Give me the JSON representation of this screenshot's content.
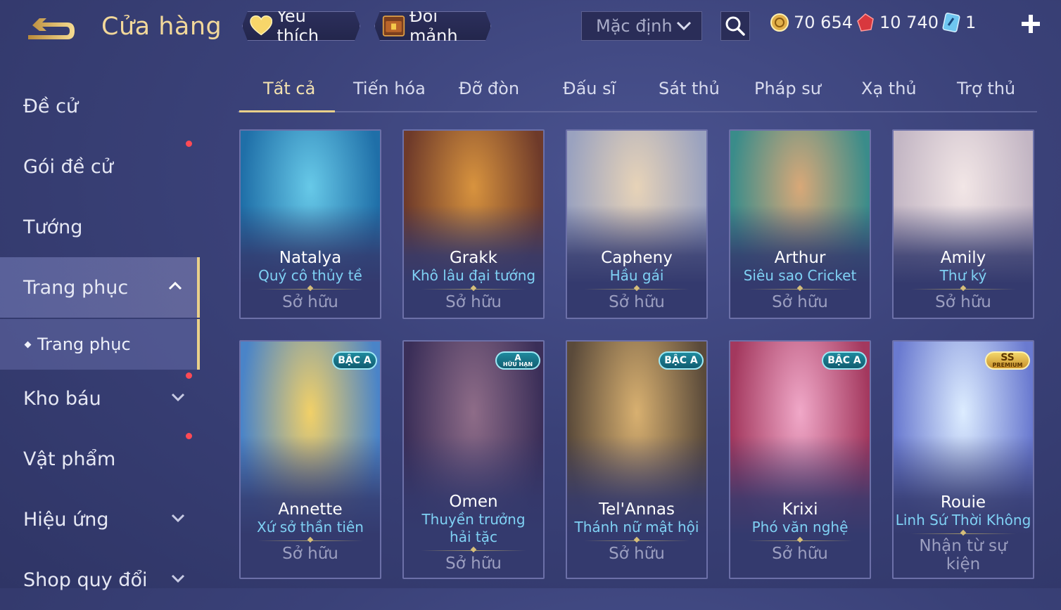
{
  "header": {
    "title": "Cửa hàng",
    "favorites_label": "Yêu thích",
    "exchange_label": "Đổi mảnh",
    "sort": {
      "selected": "Mặc định"
    },
    "currencies": [
      {
        "icon": "gold-coin-icon",
        "value": "70 654"
      },
      {
        "icon": "red-gem-icon",
        "value": "10 740"
      },
      {
        "icon": "blue-ticket-icon",
        "value": "1"
      }
    ]
  },
  "sidebar": {
    "items": [
      {
        "label": "Đề cử",
        "dot": false,
        "chevron": ""
      },
      {
        "label": "Gói đề cử",
        "dot": true,
        "chevron": ""
      },
      {
        "label": "Tướng",
        "dot": false,
        "chevron": ""
      },
      {
        "label": "Trang phục",
        "dot": false,
        "chevron": "up",
        "active": true
      },
      {
        "label": "Kho báu",
        "dot": true,
        "chevron": "down"
      },
      {
        "label": "Vật phẩm",
        "dot": true,
        "chevron": ""
      },
      {
        "label": "Hiệu ứng",
        "dot": false,
        "chevron": "down"
      },
      {
        "label": "Shop quy đổi",
        "dot": false,
        "chevron": "down"
      }
    ],
    "sub_item": "Trang phục"
  },
  "tabs": [
    "Tất cả",
    "Tiến hóa",
    "Đỡ đòn",
    "Đấu sĩ",
    "Sát thủ",
    "Pháp sư",
    "Xạ thủ",
    "Trợ thủ"
  ],
  "active_tab": "Tất cả",
  "cards": [
    {
      "name": "Natalya",
      "skin": "Quý cô thủy tề",
      "status": "Sở hữu",
      "badge": "",
      "colors": [
        "#1f6fa8",
        "#67c9e8"
      ]
    },
    {
      "name": "Grakk",
      "skin": "Khô lâu đại tướng",
      "status": "Sở hữu",
      "badge": "",
      "colors": [
        "#6e3a2a",
        "#d8933e"
      ]
    },
    {
      "name": "Capheny",
      "skin": "Hầu gái",
      "status": "Sở hữu",
      "badge": "",
      "colors": [
        "#9aa2bf",
        "#e7d3b8"
      ]
    },
    {
      "name": "Arthur",
      "skin": "Siêu sao Cricket",
      "status": "Sở hữu",
      "badge": "",
      "colors": [
        "#3a8c8a",
        "#d8a878"
      ]
    },
    {
      "name": "Amily",
      "skin": "Thư ký",
      "status": "Sở hữu",
      "badge": "",
      "colors": [
        "#c3b6c4",
        "#f2e6e6"
      ]
    },
    {
      "name": "Annette",
      "skin": "Xứ sở thần tiên",
      "status": "Sở hữu",
      "badge": "BẬC A",
      "colors": [
        "#4a84c8",
        "#f1d068"
      ]
    },
    {
      "name": "Omen",
      "skin": "Thuyền trưởng hải tặc",
      "status": "Sở hữu",
      "badge": "A",
      "badge_sub": "HỮU HẠN",
      "colors": [
        "#3a2e58",
        "#8e6c88"
      ]
    },
    {
      "name": "Tel'Annas",
      "skin": "Thánh nữ mật hội",
      "status": "Sở hữu",
      "badge": "BẬC A",
      "colors": [
        "#5a4a3a",
        "#d8b070"
      ]
    },
    {
      "name": "Krixi",
      "skin": "Phó văn nghệ",
      "status": "Sở hữu",
      "badge": "BẬC A",
      "colors": [
        "#a3385e",
        "#f0a8c8"
      ]
    },
    {
      "name": "Rouie",
      "skin": "Linh Sứ Thời Không",
      "status": "Nhận từ sự kiện",
      "badge": "SS",
      "badge_sub": "PREMIUM",
      "colors": [
        "#6a7ad0",
        "#dcecff"
      ]
    }
  ]
}
